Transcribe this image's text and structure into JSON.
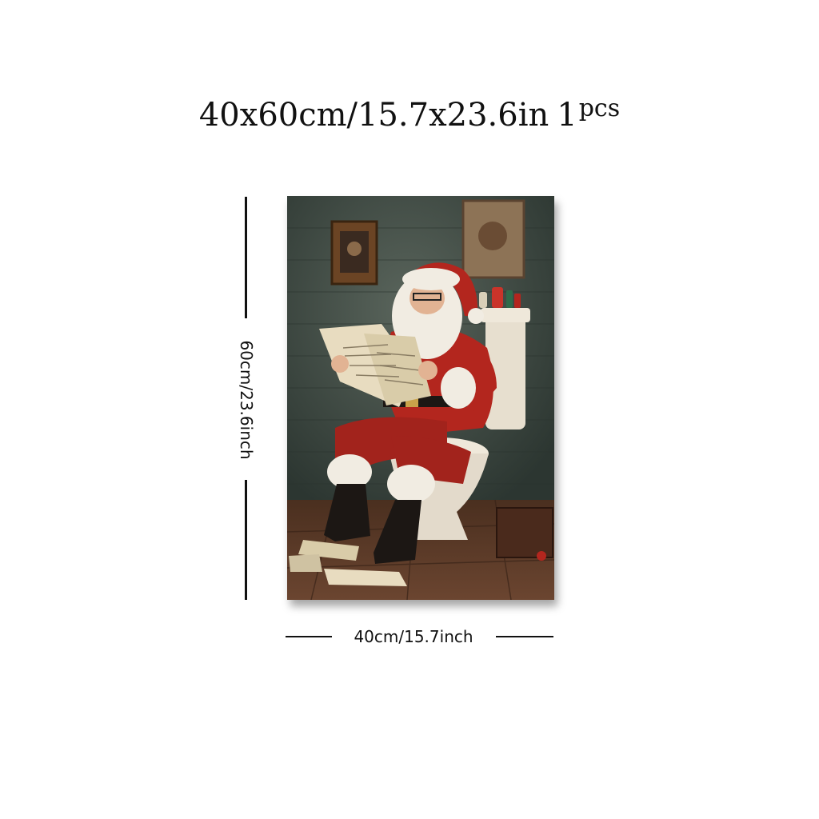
{
  "header": {
    "title": "40x60cm/15.7x23.6in",
    "quantity": "1",
    "quantity_unit": "pcs"
  },
  "dimensions": {
    "height_label": "60cm/23.6inch",
    "width_label": "40cm/15.7inch"
  },
  "artwork": {
    "subject": "santa-on-toilet-reading-newspaper",
    "colors": {
      "wall": "#3f4c46",
      "floor": "#5a3a26",
      "suit_red": "#b3261e",
      "fur_white": "#f1ece2",
      "boot_black": "#1c1714"
    }
  }
}
